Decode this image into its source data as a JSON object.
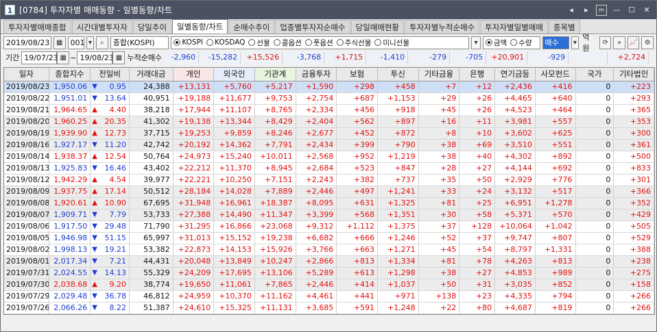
{
  "window": {
    "number": "1",
    "title": "[0784] 투자자별 매매동향 - 일별동향/차트"
  },
  "tabs": [
    "투자자별매매종합",
    "시간대별투자자",
    "당일추이",
    "일별동향/차트",
    "순매수추이",
    "업종별투자자순매수",
    "당일매매현황",
    "투자자별누적순매수",
    "투자자별일별매매",
    "종목별"
  ],
  "toolbar": {
    "date": "2019/08/23",
    "code": "001",
    "index_name": "종합(KOSPI)",
    "market_options": [
      "KOSPI",
      "KOSDAQ",
      "선물",
      "콜옵션",
      "풋옵션",
      "주식선물",
      "미니선물"
    ],
    "market_selected": "KOSPI",
    "unit_options": [
      "금액",
      "수량"
    ],
    "unit_selected": "금액",
    "trade_type": "매수",
    "unit_label": "억원"
  },
  "period": {
    "label": "기간",
    "from": "19/07/23",
    "to": "19/08/23",
    "sum_label": "누적순매수",
    "sums": [
      "-2,960",
      "-15,282",
      "+15,526",
      "-3,768",
      "+1,715",
      "-1,410",
      "-279",
      "-705",
      "+20,901",
      "-929",
      "",
      "+2,724"
    ]
  },
  "table": {
    "headers": [
      "일자",
      "종합지수",
      "전일비",
      "거래대금",
      "개인",
      "외국인",
      "기관계",
      "금융투자",
      "보험",
      "투신",
      "기타금융",
      "은행",
      "연기금등",
      "사모펀드",
      "국가",
      "기타법인"
    ],
    "rows": [
      [
        "2019/08/23",
        "1,950.06",
        "dn",
        "0.95",
        "24,388",
        "+13,131",
        "+5,760",
        "+5,217",
        "+1,590",
        "+298",
        "+458",
        "+7",
        "+12",
        "+2,436",
        "+416",
        "0",
        "+223"
      ],
      [
        "2019/08/22",
        "1,951.01",
        "dn",
        "13.64",
        "40,951",
        "+19,188",
        "+11,677",
        "+9,753",
        "+2,754",
        "+687",
        "+1,153",
        "+29",
        "+26",
        "+4,465",
        "+640",
        "0",
        "+293"
      ],
      [
        "2019/08/21",
        "1,964.65",
        "up",
        "4.40",
        "38,218",
        "+17,944",
        "+11,107",
        "+8,765",
        "+2,334",
        "+456",
        "+918",
        "+45",
        "+26",
        "+4,523",
        "+464",
        "0",
        "+365"
      ],
      [
        "2019/08/20",
        "1,960.25",
        "up",
        "20.35",
        "41,302",
        "+19,138",
        "+13,344",
        "+8,429",
        "+2,404",
        "+562",
        "+897",
        "+16",
        "+11",
        "+3,981",
        "+557",
        "0",
        "+353"
      ],
      [
        "2019/08/19",
        "1,939.90",
        "up",
        "12.73",
        "37,715",
        "+19,253",
        "+9,859",
        "+8,246",
        "+2,677",
        "+452",
        "+872",
        "+8",
        "+10",
        "+3,602",
        "+625",
        "0",
        "+300"
      ],
      [
        "2019/08/16",
        "1,927.17",
        "dn",
        "11.20",
        "42,742",
        "+20,192",
        "+14,362",
        "+7,791",
        "+2,434",
        "+399",
        "+790",
        "+38",
        "+69",
        "+3,510",
        "+551",
        "0",
        "+361"
      ],
      [
        "2019/08/14",
        "1,938.37",
        "up",
        "12.54",
        "50,764",
        "+24,973",
        "+15,240",
        "+10,011",
        "+2,568",
        "+952",
        "+1,219",
        "+38",
        "+40",
        "+4,302",
        "+892",
        "0",
        "+500"
      ],
      [
        "2019/08/13",
        "1,925.83",
        "dn",
        "16.46",
        "43,402",
        "+22,212",
        "+11,370",
        "+8,945",
        "+2,684",
        "+523",
        "+847",
        "+28",
        "+27",
        "+4,144",
        "+692",
        "0",
        "+833"
      ],
      [
        "2019/08/12",
        "1,942.29",
        "up",
        "4.54",
        "39,977",
        "+22,221",
        "+10,250",
        "+7,151",
        "+2,243",
        "+382",
        "+737",
        "+35",
        "+50",
        "+2,929",
        "+776",
        "0",
        "+301"
      ],
      [
        "2019/08/09",
        "1,937.75",
        "up",
        "17.14",
        "50,512",
        "+28,184",
        "+14,028",
        "+7,889",
        "+2,446",
        "+497",
        "+1,241",
        "+33",
        "+24",
        "+3,132",
        "+517",
        "0",
        "+366"
      ],
      [
        "2019/08/08",
        "1,920.61",
        "up",
        "10.90",
        "67,695",
        "+31,948",
        "+16,961",
        "+18,387",
        "+8,095",
        "+631",
        "+1,325",
        "+81",
        "+25",
        "+6,951",
        "+1,278",
        "0",
        "+352"
      ],
      [
        "2019/08/07",
        "1,909.71",
        "dn",
        "7.79",
        "53,733",
        "+27,388",
        "+14,490",
        "+11,347",
        "+3,399",
        "+568",
        "+1,351",
        "+30",
        "+58",
        "+5,371",
        "+570",
        "0",
        "+429"
      ],
      [
        "2019/08/06",
        "1,917.50",
        "dn",
        "29.48",
        "71,790",
        "+31,295",
        "+16,866",
        "+23,068",
        "+9,312",
        "+1,112",
        "+1,375",
        "+37",
        "+128",
        "+10,064",
        "+1,042",
        "0",
        "+505"
      ],
      [
        "2019/08/05",
        "1,946.98",
        "dn",
        "51.15",
        "65,997",
        "+31,013",
        "+15,152",
        "+19,238",
        "+6,682",
        "+666",
        "+1,246",
        "+52",
        "+37",
        "+9,747",
        "+807",
        "0",
        "+529"
      ],
      [
        "2019/08/02",
        "1,998.13",
        "dn",
        "19.21",
        "53,382",
        "+22,873",
        "+14,153",
        "+15,926",
        "+3,766",
        "+663",
        "+1,271",
        "+45",
        "+54",
        "+8,797",
        "+1,331",
        "0",
        "+388"
      ],
      [
        "2019/08/01",
        "2,017.34",
        "dn",
        "7.21",
        "44,431",
        "+20,048",
        "+13,849",
        "+10,247",
        "+2,866",
        "+813",
        "+1,334",
        "+81",
        "+78",
        "+4,263",
        "+813",
        "0",
        "+238"
      ],
      [
        "2019/07/31",
        "2,024.55",
        "dn",
        "14.13",
        "55,329",
        "+24,209",
        "+17,695",
        "+13,106",
        "+5,289",
        "+613",
        "+1,298",
        "+38",
        "+27",
        "+4,853",
        "+989",
        "0",
        "+275"
      ],
      [
        "2019/07/30",
        "2,038.68",
        "up",
        "9.20",
        "38,774",
        "+19,650",
        "+11,061",
        "+7,865",
        "+2,446",
        "+414",
        "+1,037",
        "+50",
        "+31",
        "+3,035",
        "+852",
        "0",
        "+158"
      ],
      [
        "2019/07/29",
        "2,029.48",
        "dn",
        "36.78",
        "46,812",
        "+24,959",
        "+10,370",
        "+11,162",
        "+4,461",
        "+441",
        "+971",
        "+138",
        "+23",
        "+4,335",
        "+794",
        "0",
        "+266"
      ],
      [
        "2019/07/26",
        "2,066.26",
        "dn",
        "8.22",
        "51,387",
        "+24,610",
        "+15,325",
        "+11,131",
        "+3,685",
        "+591",
        "+1,248",
        "+22",
        "+80",
        "+4,687",
        "+819",
        "0",
        "+266"
      ]
    ]
  },
  "colors": {
    "up": "#e2100f",
    "down": "#1d3ed0",
    "selected_row": "#cfe0f6",
    "title_bar": "#4b5160"
  }
}
